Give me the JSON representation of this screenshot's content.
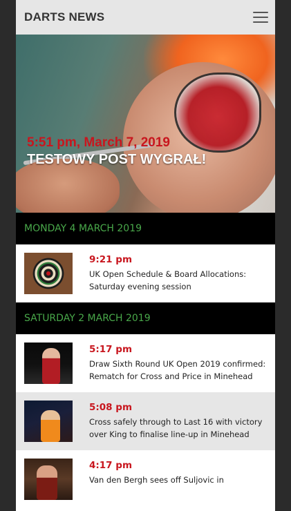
{
  "header": {
    "brand": "DARTS NEWS",
    "menu_icon": "hamburger-icon"
  },
  "hero": {
    "time": "5:51 pm, March 7, 2019",
    "title": "TESTOWY POST WYGRAŁ!"
  },
  "sections": [
    {
      "date": "MONDAY 4 MARCH 2019",
      "items": [
        {
          "time": "9:21 pm",
          "title": "UK Open Schedule & Board Allocations: Saturday evening session"
        }
      ]
    },
    {
      "date": "SATURDAY 2 MARCH 2019",
      "items": [
        {
          "time": "5:17 pm",
          "title": "Draw Sixth Round UK Open 2019 confirmed: Rematch for Cross and Price in Minehead"
        },
        {
          "time": "5:08 pm",
          "title": "Cross safely through to Last 16 with victory over King to finalise line-up in Minehead"
        },
        {
          "time": "4:17 pm",
          "title": "Van den Bergh sees off Suljovic in"
        }
      ]
    }
  ],
  "colors": {
    "accent_red": "#c8161e",
    "date_green": "#49a84a",
    "header_bg": "#e6e6e6"
  }
}
